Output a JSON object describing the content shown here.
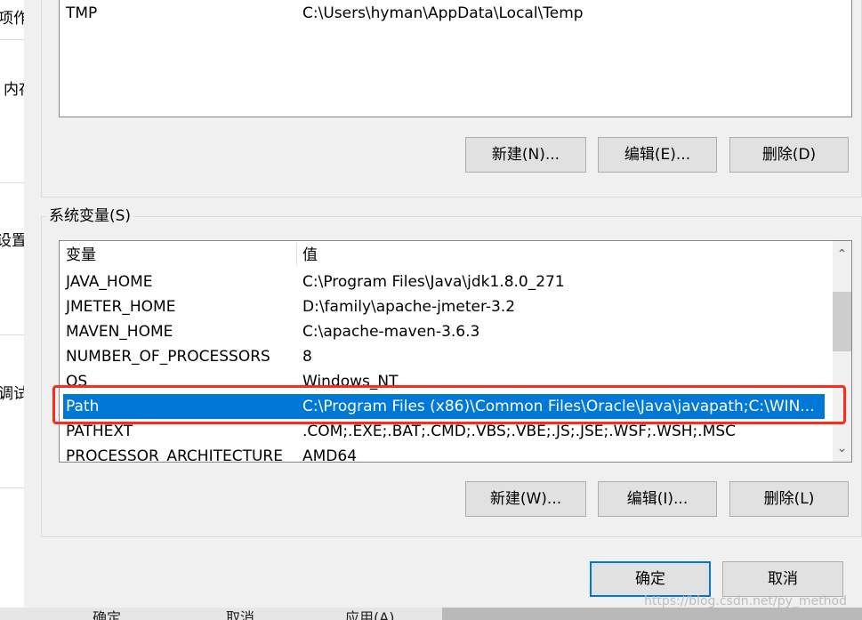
{
  "background_window": {
    "fragments": [
      "项作",
      "内存",
      "设置",
      "调试信"
    ],
    "bottom_fragments": [
      "确定",
      "取消",
      "应用(A)"
    ]
  },
  "user_vars": {
    "rows": [
      {
        "name": "TMP",
        "value": "C:\\Users\\hyman\\AppData\\Local\\Temp"
      }
    ],
    "buttons": {
      "new": "新建(N)...",
      "edit": "编辑(E)...",
      "delete": "删除(D)"
    }
  },
  "system_vars": {
    "title": "系统变量(S)",
    "headers": {
      "name": "变量",
      "value": "值"
    },
    "rows": [
      {
        "name": "JAVA_HOME",
        "value": "C:\\Program Files\\Java\\jdk1.8.0_271"
      },
      {
        "name": "JMETER_HOME",
        "value": "D:\\family\\apache-jmeter-3.2"
      },
      {
        "name": "MAVEN_HOME",
        "value": "C:\\apache-maven-3.6.3"
      },
      {
        "name": "NUMBER_OF_PROCESSORS",
        "value": "8"
      },
      {
        "name": "OS",
        "value": "Windows_NT"
      },
      {
        "name": "Path",
        "value": "C:\\Program Files (x86)\\Common Files\\Oracle\\Java\\javapath;C:\\WIN..."
      },
      {
        "name": "PATHEXT",
        "value": ".COM;.EXE;.BAT;.CMD;.VBS;.VBE;.JS;.JSE;.WSF;.WSH;.MSC"
      },
      {
        "name": "PROCESSOR_ARCHITECTURE",
        "value": "AMD64"
      }
    ],
    "selected_row": "Path",
    "buttons": {
      "new": "新建(W)...",
      "edit": "编辑(I)...",
      "delete": "删除(L)"
    }
  },
  "footer": {
    "ok": "确定",
    "cancel": "取消"
  },
  "watermark": "https://blog.csdn.net/py_method",
  "colors": {
    "selection": "#0078d7",
    "highlight_box": "#ff2a1a",
    "default_button_border": "#0078d7"
  }
}
